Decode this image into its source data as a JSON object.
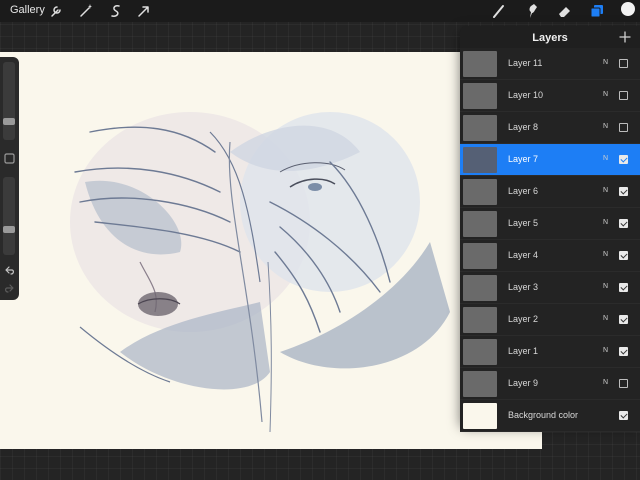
{
  "toolbar": {
    "gallery_label": "Gallery",
    "left_tools": [
      "wrench-icon",
      "magic-wand-icon",
      "selection-icon",
      "transform-arrow-icon"
    ],
    "right_tools": [
      "brush-icon",
      "smudge-icon",
      "eraser-icon",
      "layers-icon"
    ],
    "active_color": "#f2f2f2",
    "accent": "#1d7ef5"
  },
  "layers_panel": {
    "title": "Layers",
    "add_label": "+",
    "layers": [
      {
        "name": "Layer 11",
        "blend": "N",
        "visible": false,
        "active": false
      },
      {
        "name": "Layer 10",
        "blend": "N",
        "visible": false,
        "active": false
      },
      {
        "name": "Layer 8",
        "blend": "N",
        "visible": false,
        "active": false
      },
      {
        "name": "Layer 7",
        "blend": "N",
        "visible": true,
        "active": true
      },
      {
        "name": "Layer 6",
        "blend": "N",
        "visible": true,
        "active": false
      },
      {
        "name": "Layer 5",
        "blend": "N",
        "visible": true,
        "active": false
      },
      {
        "name": "Layer 4",
        "blend": "N",
        "visible": true,
        "active": false
      },
      {
        "name": "Layer 3",
        "blend": "N",
        "visible": true,
        "active": false
      },
      {
        "name": "Layer 2",
        "blend": "N",
        "visible": true,
        "active": false
      },
      {
        "name": "Layer 1",
        "blend": "N",
        "visible": true,
        "active": false
      },
      {
        "name": "Layer 9",
        "blend": "N",
        "visible": false,
        "active": false
      }
    ],
    "background": {
      "name": "Background color",
      "visible": true,
      "color": "#faf7ec"
    }
  },
  "sidebar": {
    "brush_size": 0.25,
    "opacity": 0.4
  }
}
